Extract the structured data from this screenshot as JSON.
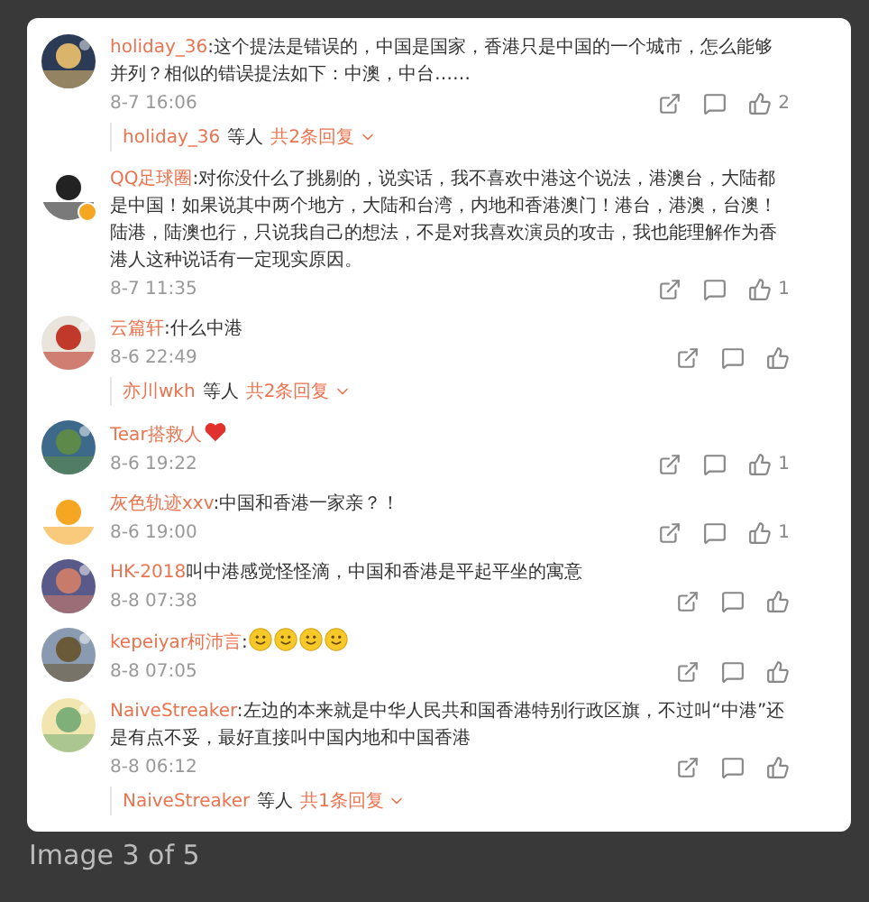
{
  "comments": [
    {
      "user": "holiday_36",
      "text": ":这个提法是错误的，中国是国家，香港只是中国的一个城市，怎么能够并列？相似的错误提法如下：中澳，中台……",
      "time": "8-7 16:06",
      "likes": "2",
      "replies": {
        "users": "holiday_36",
        "others": "等人",
        "count": "共2条回复"
      }
    },
    {
      "user": "QQ足球圈",
      "verified": true,
      "text": ":对你没什么了挑剔的，说实话，我不喜欢中港这个说法，港澳台，大陆都是中国！如果说其中两个地方，大陆和台湾，内地和香港澳门！港台，港澳，台澳！陆港，陆澳也行，只说我自己的想法，不是对我喜欢演员的攻击，我也能理解作为香港人这种说话有一定现实原因。",
      "time": "8-7 11:35",
      "likes": "1"
    },
    {
      "user": "云篇轩",
      "text": ":什么中港",
      "time": "8-6 22:49",
      "replies": {
        "users": "亦川wkh",
        "others": "等人",
        "count": "共2条回复"
      }
    },
    {
      "user": "Tear搭救人",
      "emoticons": [
        {
          "kind": "heart"
        }
      ],
      "time": "8-6 19:22",
      "likes": "1"
    },
    {
      "user": "灰色轨迹xxv",
      "text": ":中国和香港一家亲？！",
      "time": "8-6 19:00",
      "likes": "1"
    },
    {
      "user": "HK-2018",
      "text": "叫中港感觉怪怪滴，中国和香港是平起平坐的寓意",
      "time": "8-8 07:38"
    },
    {
      "user": "kepeiyar柯沛言",
      "text": ":",
      "emoticons": [
        {
          "kind": "smile"
        },
        {
          "kind": "smile"
        },
        {
          "kind": "smile"
        },
        {
          "kind": "smile"
        }
      ],
      "time": "8-8 07:05"
    },
    {
      "user": "NaiveStreaker",
      "text": ":左边的本来就是中华人民共和国香港特别行政区旗，不过叫“中港”还是有点不妥，最好直接叫中国内地和中国香港",
      "time": "8-8 06:12",
      "replies": {
        "users": "NaiveStreaker",
        "others": "等人",
        "count": "共1条回复"
      }
    }
  ],
  "caption": "Image 3 of 5"
}
